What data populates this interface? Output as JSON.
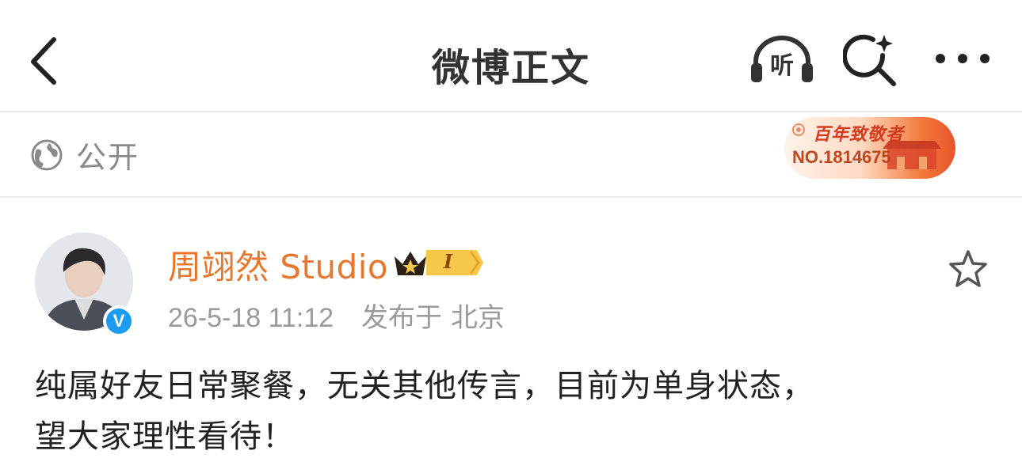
{
  "navbar": {
    "title": "微博正文",
    "listen_label": "听"
  },
  "visibility": {
    "label": "公开"
  },
  "badge": {
    "title": "百年致敬者",
    "number": "NO.1814675"
  },
  "post": {
    "author": "周翊然 Studio",
    "vip_level": "I",
    "time": "26-5-18 11:12",
    "location_prefix": "发布于",
    "location": "北京",
    "content_lines": [
      "纯属好友日常聚餐，无关其他传言，目前为单身状态，",
      "望大家理性看待！"
    ]
  },
  "colors": {
    "accent_orange": "#e8772e",
    "verified_blue": "#1d9bf0",
    "meta_gray": "#9a9a9a"
  },
  "icons": [
    "back-arrow-icon",
    "headphones-icon",
    "search-sparkle-icon",
    "more-dots-icon",
    "globe-icon",
    "crown-icon",
    "verified-icon",
    "star-outline-icon"
  ]
}
